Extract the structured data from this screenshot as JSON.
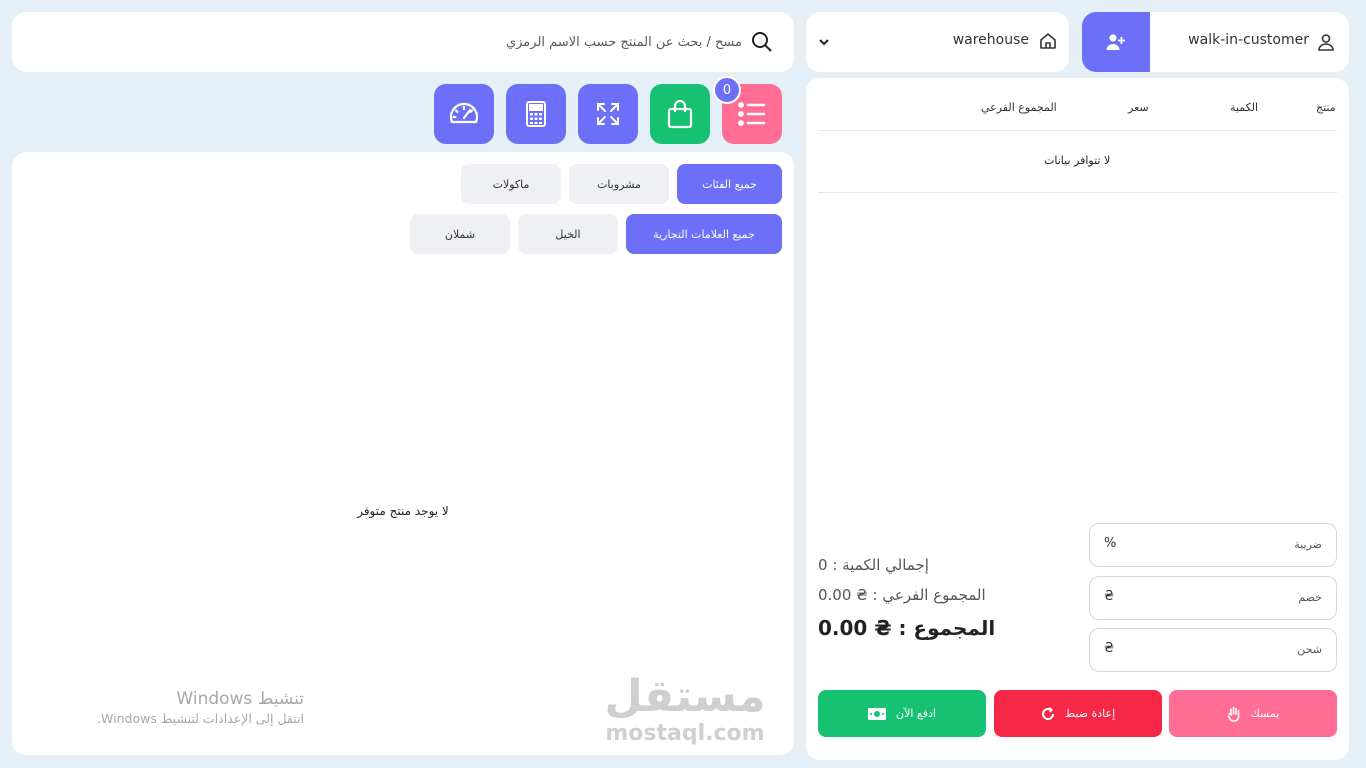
{
  "search": {
    "placeholder": "مسح / بحث عن المنتج حسب الاسم الرمزي"
  },
  "cart_badge": {
    "count": "0"
  },
  "toolbar": {
    "icons": [
      "list-icon",
      "shopping-bag-icon",
      "fullscreen-icon",
      "calculator-icon",
      "dashboard-icon"
    ]
  },
  "categories": {
    "all": "جميع الفئات",
    "drinks": "مشروبات",
    "food": "ماكولات"
  },
  "brands": {
    "all": "جميع العلامات التجارية",
    "alkhail": "الخيل",
    "shamlan": "شملان"
  },
  "products": {
    "empty_message": "لا يوجد منتج متوفر"
  },
  "customer": {
    "name": "walk-in-customer"
  },
  "warehouse": {
    "name": "warehouse"
  },
  "cart_table": {
    "headers": {
      "product": "منتج",
      "qty": "الكمية",
      "price": "سعر",
      "subtotal": "المجموع الفرعي"
    },
    "empty_message": "لا تتوافر بيانات"
  },
  "fields": {
    "tax": {
      "label": "ضريبة",
      "symbol": "%"
    },
    "discount": {
      "label": "خصم",
      "symbol": "₴"
    },
    "shipping": {
      "label": "شحن",
      "symbol": "₴"
    }
  },
  "summary": {
    "total_qty": "إجمالي الكمية : 0",
    "subtotal": "المجموع الفرعي : ₴ 0.00",
    "total": "المجموع : ₴ 0.00"
  },
  "actions": {
    "pay": "ادفع الآن",
    "reset": "إعادة ضبط",
    "hold": "يمسك"
  },
  "watermarks": {
    "windows_title": "تنشيط Windows",
    "windows_sub": "انتقل إلى الإعدادات لتنشيط Windows.",
    "mostaql_ar": "مستقل",
    "mostaql_en": "mostaql.com"
  },
  "colors": {
    "accent": "#6c70f8",
    "pink": "#ff6d95",
    "green": "#16c172",
    "red": "#f72847",
    "background": "#e4eff7"
  }
}
